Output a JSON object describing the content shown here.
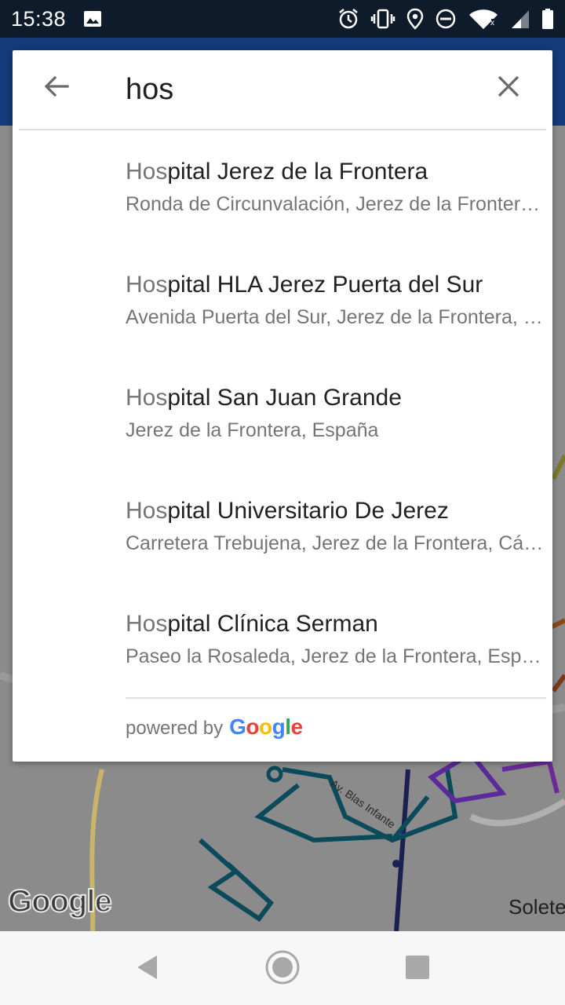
{
  "status_bar": {
    "time": "15:38",
    "icons": [
      "image-icon",
      "alarm-icon",
      "vibrate-icon",
      "location-icon",
      "dnd-icon",
      "wifi-icon",
      "signal-icon",
      "battery-icon"
    ]
  },
  "search": {
    "query": "hos",
    "back_icon": "arrow-back-icon",
    "clear_icon": "close-icon"
  },
  "results": [
    {
      "match": "Hos",
      "rest": "pital Jerez de la Frontera",
      "subtitle": "Ronda de Circunvalación, Jerez de la Frontera, España"
    },
    {
      "match": "Hos",
      "rest": "pital HLA Jerez Puerta del Sur",
      "subtitle": "Avenida Puerta del Sur, Jerez de la Frontera, España"
    },
    {
      "match": "Hos",
      "rest": "pital San Juan Grande",
      "subtitle": "Jerez de la Frontera, España"
    },
    {
      "match": "Hos",
      "rest": "pital Universitario De Jerez",
      "subtitle": "Carretera Trebujena, Jerez de la Frontera, Cádiz, España"
    },
    {
      "match": "Hos",
      "rest": "pital Clínica Serman",
      "subtitle": "Paseo la Rosaleda, Jerez de la Frontera, España"
    }
  ],
  "footer": {
    "powered_by": "powered by",
    "google_letters": [
      {
        "ch": "G",
        "color": "#4285F4"
      },
      {
        "ch": "o",
        "color": "#EA4335"
      },
      {
        "ch": "o",
        "color": "#FBBC05"
      },
      {
        "ch": "g",
        "color": "#4285F4"
      },
      {
        "ch": "l",
        "color": "#34A853"
      },
      {
        "ch": "e",
        "color": "#EA4335"
      }
    ]
  },
  "map": {
    "logo": "Google",
    "street_label": "Av. Blas Infante",
    "place_label": "Solete"
  },
  "nav_bar": {
    "icons": [
      "back-triangle-icon",
      "home-circle-icon",
      "recents-square-icon"
    ]
  },
  "colors": {
    "status_bar": "#0d1b2a",
    "app_bar": "#143a7a",
    "match_text": "#757575",
    "title_text": "#212121"
  }
}
